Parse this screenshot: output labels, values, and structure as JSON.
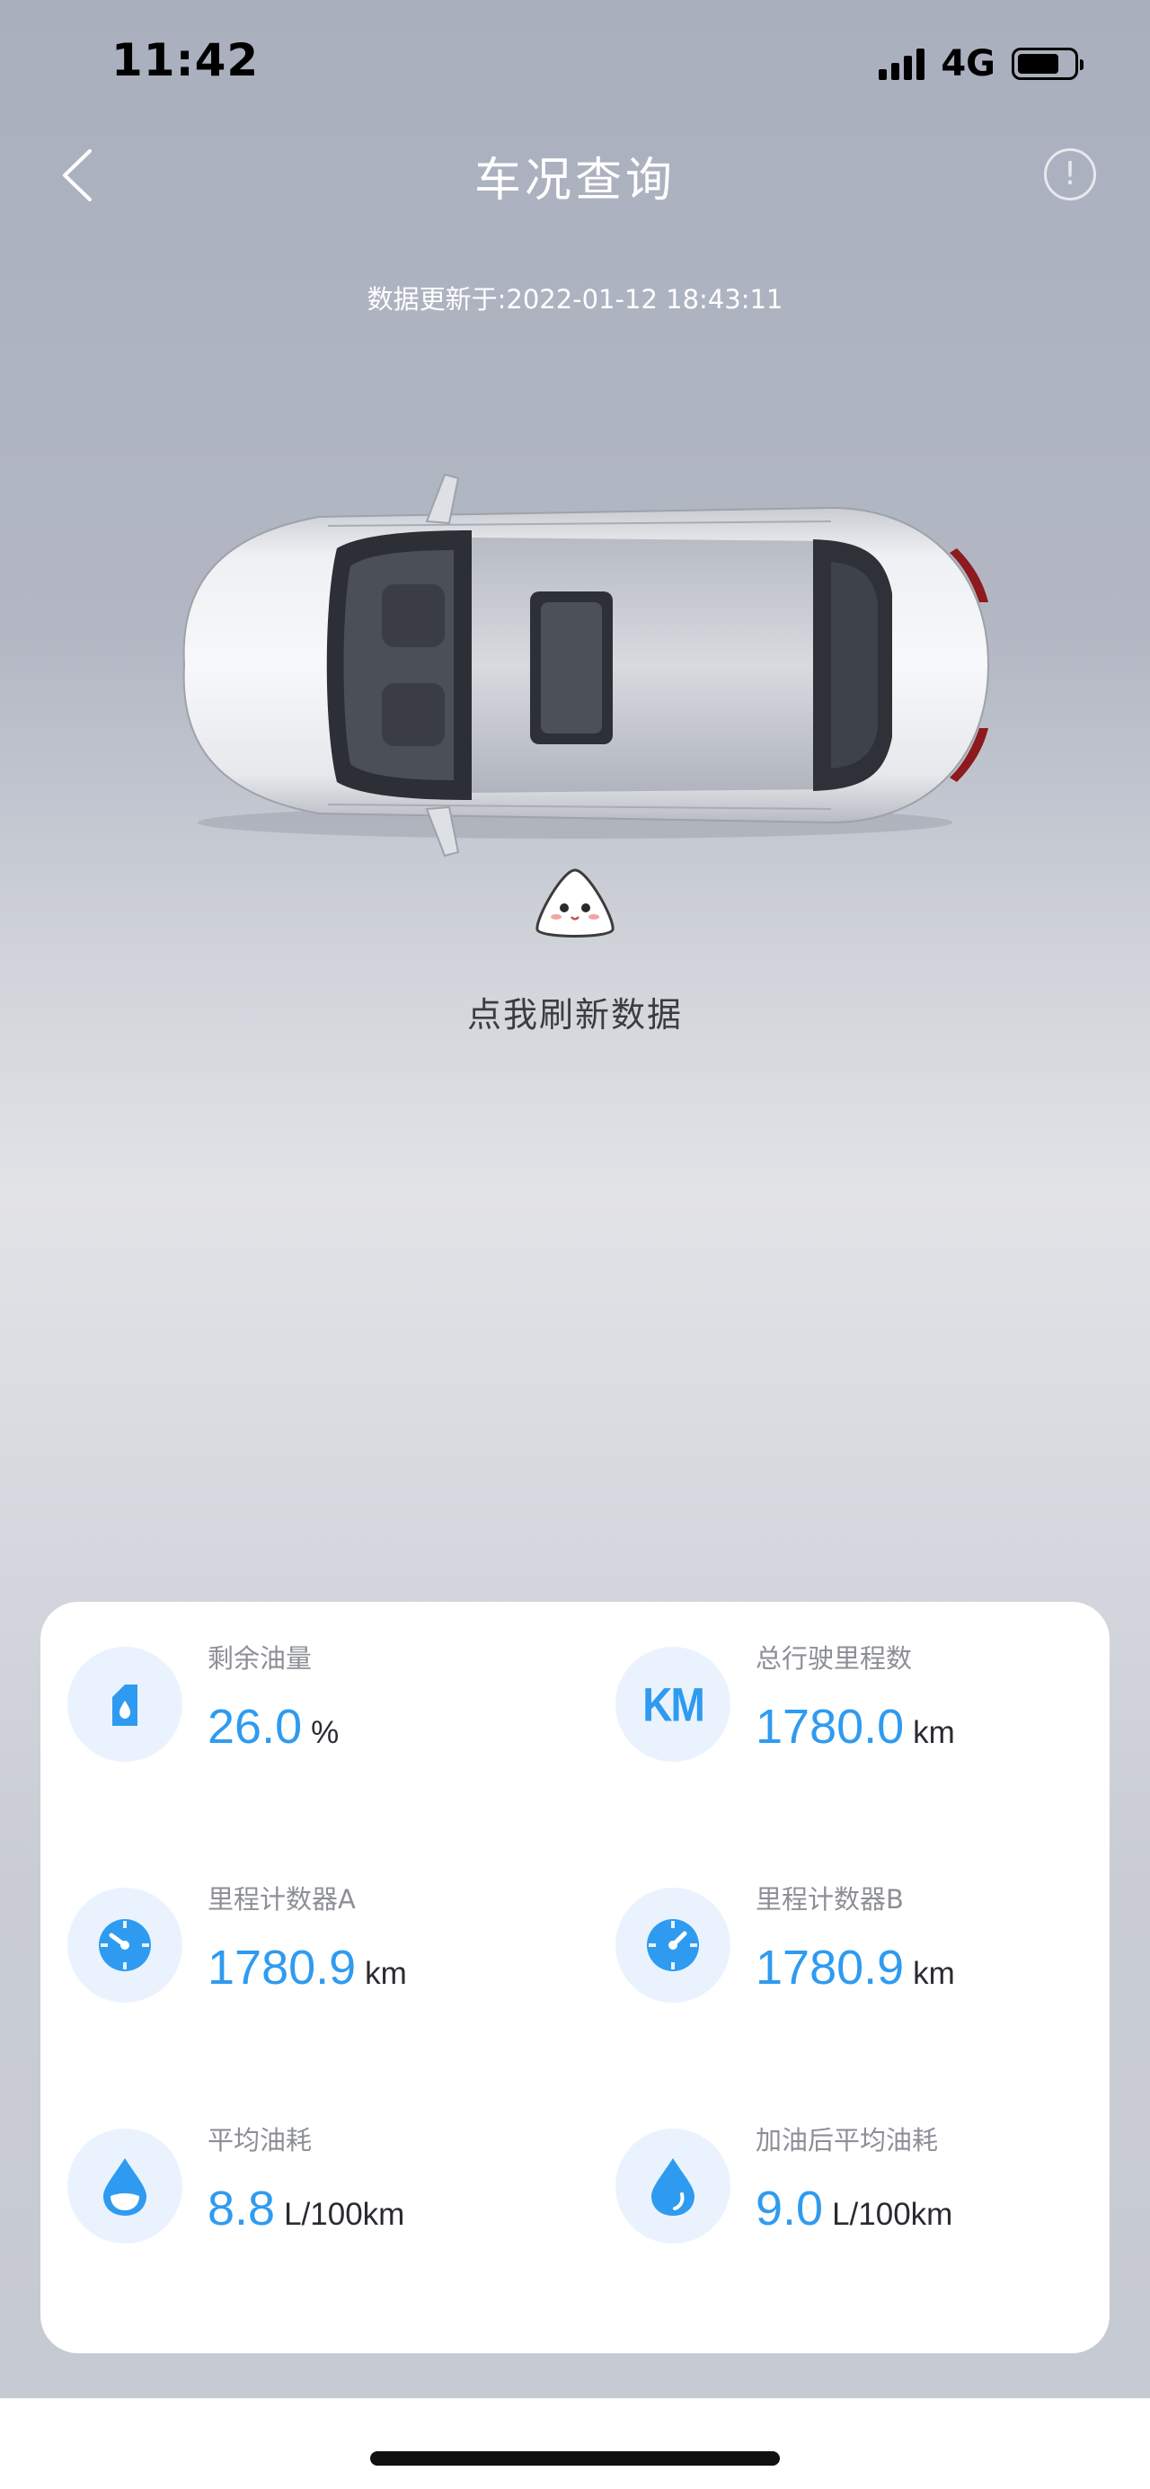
{
  "status_bar": {
    "time": "11:42",
    "network": "4G",
    "battery_level": 0.75
  },
  "header": {
    "title": "车况查询",
    "back_icon": "chevron-left-icon",
    "info_icon": "exclamation-circle-icon"
  },
  "updated_text": "数据更新于:2022-01-12 18:43:11",
  "refresh_label": "点我刷新数据",
  "stats": [
    {
      "label": "剩余油量",
      "value": "26.0",
      "unit": "%",
      "icon": "fuel-can-icon"
    },
    {
      "label": "总行驶里程数",
      "value": "1780.0",
      "unit": "km",
      "icon": "km-icon",
      "icon_text": "KM"
    },
    {
      "label": "里程计数器A",
      "value": "1780.9",
      "unit": "km",
      "icon": "gauge-icon"
    },
    {
      "label": "里程计数器B",
      "value": "1780.9",
      "unit": "km",
      "icon": "gauge-icon"
    },
    {
      "label": "平均油耗",
      "value": "8.8",
      "unit": "L/100km",
      "icon": "fuel-drop-icon"
    },
    {
      "label": "加油后平均油耗",
      "value": "9.0",
      "unit": "L/100km",
      "icon": "drop-icon"
    }
  ],
  "colors": {
    "accent": "#2f9bf0",
    "icon_bg": "#eaf3fd",
    "label": "#8d8f96"
  }
}
